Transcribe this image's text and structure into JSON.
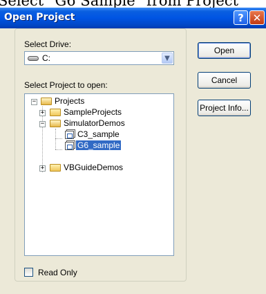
{
  "caption": "Select \"G6 Sample\" from Project",
  "window": {
    "title": "Open Project"
  },
  "titlebar": {
    "help_icon": "question-mark-icon",
    "close_icon": "close-x-icon"
  },
  "drive": {
    "label": "Select Drive:",
    "value": "C:",
    "icon": "hard-drive-icon"
  },
  "project": {
    "label": "Select Project to open:"
  },
  "tree": {
    "root": "Projects",
    "items": [
      "SampleProjects",
      "SimulatorDemos",
      "C3_sample",
      "G6_sample",
      "VBGuideDemos"
    ],
    "selected": "G6_sample",
    "icons": {
      "collapsed": "plus-icon",
      "expanded": "minus-icon",
      "folder": "folder-icon",
      "project": "project-file-icon"
    }
  },
  "read_only": {
    "label": "Read Only",
    "checked": false
  },
  "buttons": {
    "open": "Open",
    "cancel": "Cancel",
    "project_info": "Project Info..."
  },
  "colors": {
    "titlebar": "#0054e3",
    "selection": "#316ac5",
    "dialog_bg": "#ece9d8"
  }
}
